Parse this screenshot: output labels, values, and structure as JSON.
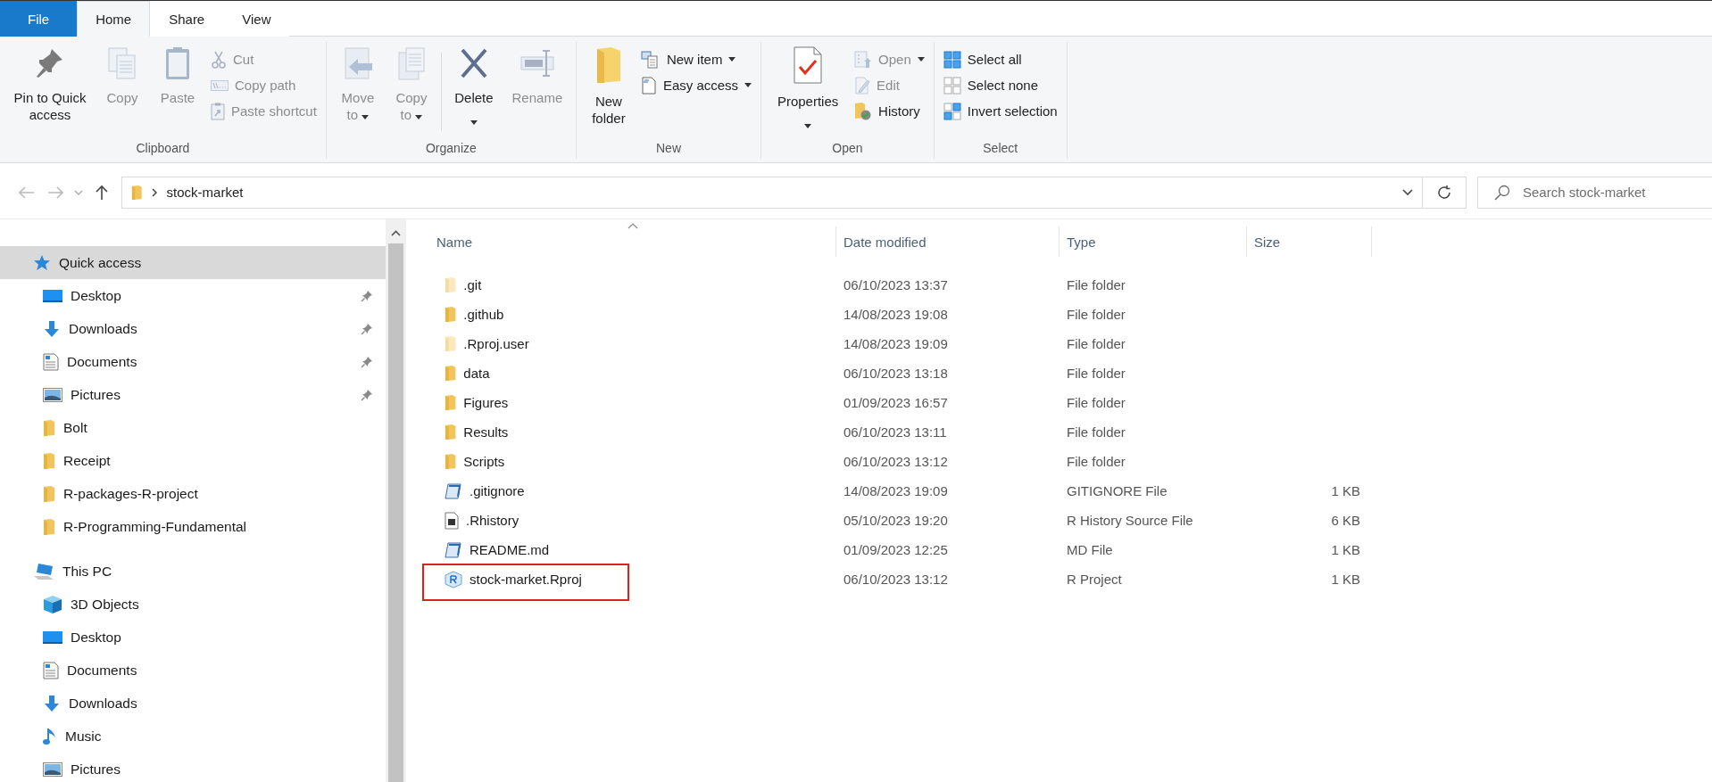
{
  "ribbon_tabs": [
    {
      "label": "File",
      "kind": "file",
      "selected": false
    },
    {
      "label": "Home",
      "kind": "tab",
      "selected": true
    },
    {
      "label": "Share",
      "kind": "tab",
      "selected": false
    },
    {
      "label": "View",
      "kind": "tab",
      "selected": false
    }
  ],
  "ribbon_groups": [
    {
      "label": "Clipboard",
      "columns": [
        {
          "kind": "large",
          "label": "Pin to Quick access",
          "disabled": false
        },
        {
          "kind": "large",
          "label": "Copy",
          "disabled": true
        },
        {
          "kind": "large",
          "label": "Paste",
          "disabled": true
        },
        {
          "kind": "stack",
          "items": [
            {
              "label": "Cut",
              "disabled": true
            },
            {
              "label": "Copy path",
              "disabled": true
            },
            {
              "label": "Paste shortcut",
              "disabled": true
            }
          ]
        }
      ]
    },
    {
      "label": "Organize",
      "columns": [
        {
          "kind": "large",
          "label": "Move to",
          "disabled": true,
          "dropdown": true
        },
        {
          "kind": "large",
          "label": "Copy to",
          "disabled": true,
          "dropdown": true
        },
        {
          "kind": "separator"
        },
        {
          "kind": "large",
          "label": "Delete",
          "disabled": false,
          "dropdown_below": true
        },
        {
          "kind": "large",
          "label": "Rename",
          "disabled": true
        }
      ]
    },
    {
      "label": "New",
      "columns": [
        {
          "kind": "large",
          "label": "New folder",
          "disabled": false
        },
        {
          "kind": "stack",
          "items": [
            {
              "label": "New item",
              "disabled": false,
              "dropdown": true
            },
            {
              "label": "Easy access",
              "disabled": false,
              "dropdown": true
            }
          ]
        }
      ]
    },
    {
      "label": "Open",
      "columns": [
        {
          "kind": "large",
          "label": "Properties",
          "disabled": false,
          "dropdown_below": true
        },
        {
          "kind": "stack",
          "items": [
            {
              "label": "Open",
              "disabled": true,
              "dropdown": true
            },
            {
              "label": "Edit",
              "disabled": true
            },
            {
              "label": "History",
              "disabled": false
            }
          ]
        }
      ]
    },
    {
      "label": "Select",
      "columns": [
        {
          "kind": "stack",
          "items": [
            {
              "label": "Select all",
              "disabled": false
            },
            {
              "label": "Select none",
              "disabled": false
            },
            {
              "label": "Invert selection",
              "disabled": false
            }
          ]
        }
      ]
    }
  ],
  "address_bar": {
    "path": [
      "stock-market"
    ]
  },
  "search": {
    "placeholder": "Search stock-market"
  },
  "navigation": [
    {
      "label": "Quick access",
      "kind": "star",
      "selected": true,
      "children": [
        {
          "label": "Desktop",
          "kind": "desktop",
          "pinned": true,
          "selected": false
        },
        {
          "label": "Downloads",
          "kind": "downloads",
          "pinned": true,
          "selected": false
        },
        {
          "label": "Documents",
          "kind": "documents",
          "pinned": true,
          "selected": false
        },
        {
          "label": "Pictures",
          "kind": "pictures",
          "pinned": true,
          "selected": false
        },
        {
          "label": "Bolt",
          "kind": "folder",
          "pinned": false,
          "selected": false
        },
        {
          "label": "Receipt",
          "kind": "folder",
          "pinned": false,
          "selected": false
        },
        {
          "label": "R-packages-R-project",
          "kind": "folder",
          "pinned": false,
          "selected": false
        },
        {
          "label": "R-Programming-Fundamental",
          "kind": "folder",
          "pinned": false,
          "selected": false
        }
      ]
    },
    {
      "label": "This PC",
      "kind": "pc",
      "selected": false,
      "children": [
        {
          "label": "3D Objects",
          "kind": "objects",
          "pinned": false,
          "selected": false
        },
        {
          "label": "Desktop",
          "kind": "desktop",
          "pinned": false,
          "selected": false
        },
        {
          "label": "Documents",
          "kind": "documents",
          "pinned": false,
          "selected": false
        },
        {
          "label": "Downloads",
          "kind": "downloads",
          "pinned": false,
          "selected": false
        },
        {
          "label": "Music",
          "kind": "music",
          "pinned": false,
          "selected": false
        },
        {
          "label": "Pictures",
          "kind": "pictures",
          "pinned": false,
          "selected": false
        }
      ]
    }
  ],
  "table": {
    "columns": [
      "Name",
      "Date modified",
      "Type",
      "Size"
    ],
    "rows": [
      {
        "name": ".git",
        "date": "06/10/2023 13:37",
        "type": "File folder",
        "kind": "folder",
        "hidden": true,
        "highlighted": false
      },
      {
        "name": ".github",
        "date": "14/08/2023 19:08",
        "type": "File folder",
        "kind": "folder",
        "hidden": false,
        "highlighted": false
      },
      {
        "name": ".Rproj.user",
        "date": "14/08/2023 19:09",
        "type": "File folder",
        "kind": "folder",
        "hidden": true,
        "highlighted": false
      },
      {
        "name": "data",
        "date": "06/10/2023 13:18",
        "type": "File folder",
        "kind": "folder",
        "hidden": false,
        "highlighted": false
      },
      {
        "name": "Figures",
        "date": "01/09/2023 16:57",
        "type": "File folder",
        "kind": "folder",
        "hidden": false,
        "highlighted": false
      },
      {
        "name": "Results",
        "date": "06/10/2023 13:11",
        "type": "File folder",
        "kind": "folder",
        "hidden": false,
        "highlighted": false
      },
      {
        "name": "Scripts",
        "date": "06/10/2023 13:12",
        "type": "File folder",
        "kind": "folder",
        "hidden": false,
        "highlighted": false
      },
      {
        "name": ".gitignore",
        "date": "14/08/2023 19:09",
        "type": "GITIGNORE File",
        "size": "1 KB",
        "kind": "text",
        "highlighted": false
      },
      {
        "name": ".Rhistory",
        "date": "05/10/2023 19:20",
        "type": "R History Source File",
        "size": "6 KB",
        "kind": "history",
        "highlighted": false
      },
      {
        "name": "README.md",
        "date": "01/09/2023 12:25",
        "type": "MD File",
        "size": "1 KB",
        "kind": "text",
        "highlighted": false
      },
      {
        "name": "stock-market.Rproj",
        "date": "06/10/2023 13:12",
        "type": "R Project",
        "size": "1 KB",
        "kind": "rproj",
        "highlighted": true
      }
    ]
  }
}
